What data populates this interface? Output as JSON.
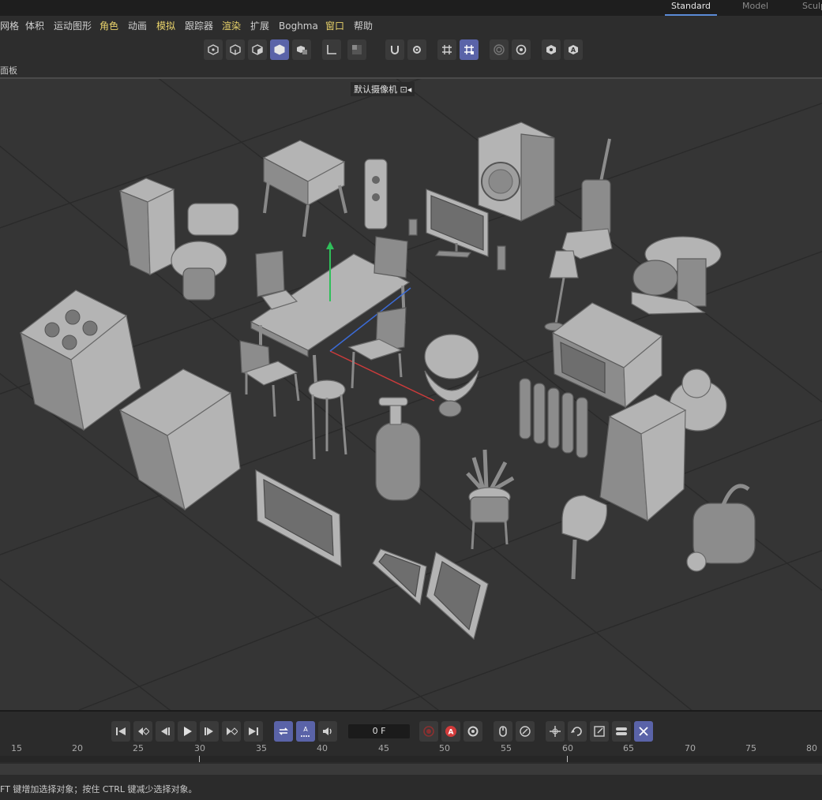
{
  "layout_tabs": [
    {
      "label": "Standard",
      "active": true
    },
    {
      "label": "Model",
      "active": false
    },
    {
      "label": "Sculp",
      "active": false
    }
  ],
  "menu": [
    "网格",
    "体积",
    "运动图形",
    "角色",
    "动画",
    "模拟",
    "跟踪器",
    "渲染",
    "扩展",
    "Boghma",
    "窗口",
    "帮助"
  ],
  "panel_label": "面板",
  "camera_label": "默认摄像机 ⊡◂",
  "frame_value": "0 F",
  "ruler_ticks": [
    "15",
    "20",
    "25",
    "30",
    "35",
    "40",
    "45",
    "50",
    "55",
    "60",
    "65",
    "70",
    "75",
    "80"
  ],
  "status_text": "FT 键增加选择对象；按住 CTRL 键减少选择对象。",
  "icons": {
    "toolbar": [
      "points-mode-icon",
      "edges-mode-icon",
      "polygons-mode-icon",
      "model-mode-icon",
      "object-axis-icon",
      "axis-icon",
      "texture-icon",
      "magnet-icon",
      "gear-snap-icon",
      "grid-snap-icon",
      "snap-enabled-icon",
      "render-region-icon",
      "render-settings-icon",
      "view-icon",
      "auto-icon"
    ],
    "playback": [
      "go-to-start-icon",
      "prev-keyframe-icon",
      "prev-frame-icon",
      "play-icon",
      "next-frame-icon",
      "next-keyframe-icon",
      "go-to-end-icon",
      "loop-icon",
      "auto-key-mode-icon",
      "sound-icon"
    ],
    "keys": [
      "record-icon",
      "autokey-icon",
      "keyframe-settings-icon",
      "mouse-icon",
      "rotate-key-icon",
      "move-key-icon",
      "rotate-icon",
      "scale-key-icon",
      "toggle-icon",
      "cross-key-icon"
    ]
  },
  "colors": {
    "accent": "#5b8bd6",
    "active_button": "#5a63a8",
    "menu_highlight": "#e9d36b",
    "record": "#d23b3b"
  }
}
